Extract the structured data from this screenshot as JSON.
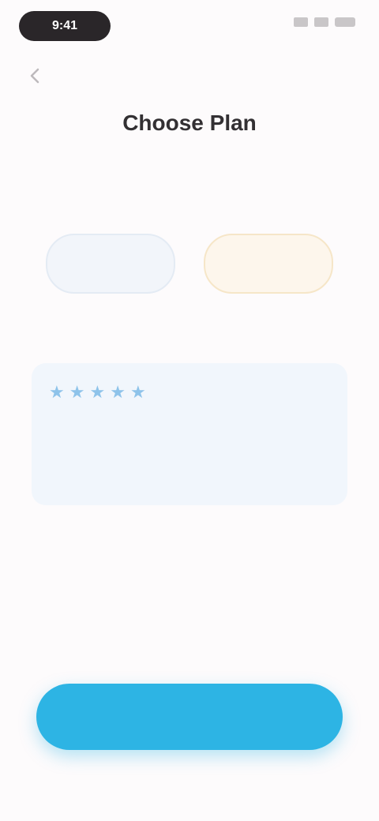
{
  "status_bar": {
    "time": "9:41"
  },
  "header": {
    "title": "Choose Plan",
    "subtitle_line_1": "",
    "subtitle_line_2": ""
  },
  "options": {
    "left_label": "",
    "right_label": ""
  },
  "card": {
    "text": "",
    "footer": ""
  },
  "actions": {
    "cta_label": "",
    "skip_label": ""
  },
  "colors": {
    "accent": "#2db4e4",
    "card_bg": "#f1f6fc",
    "gold": "#c9a46a"
  }
}
